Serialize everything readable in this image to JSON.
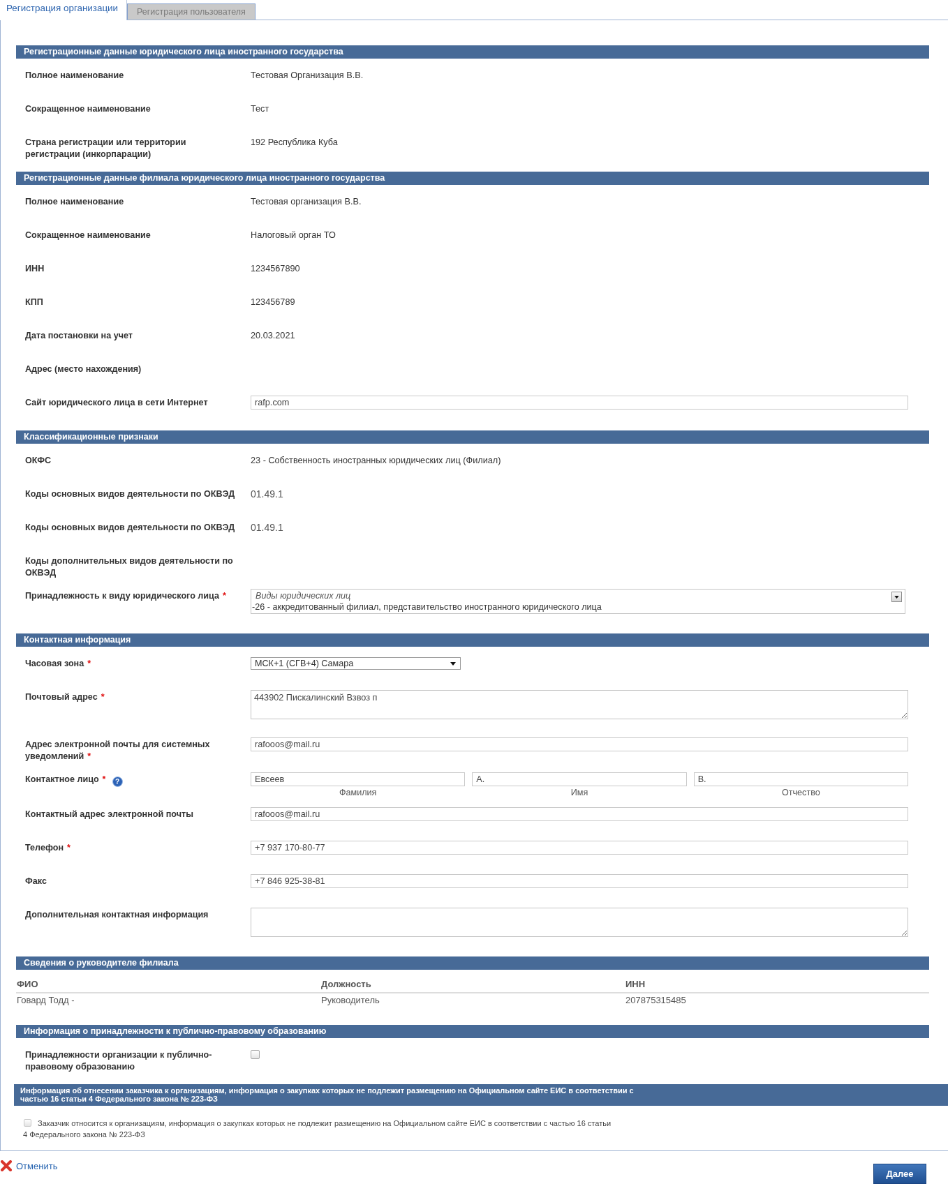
{
  "tabs": [
    {
      "label": "Регистрация организации",
      "selected": true
    },
    {
      "label": "Регистрация пользователя",
      "selected": false
    }
  ],
  "sections": [
    {
      "kind": "form",
      "title": "Регистрационные данные юридического лица иностранного государства",
      "rows": [
        {
          "kind": "text",
          "label": "Полное наименование",
          "value": "Тестовая Организация В.В."
        },
        {
          "kind": "text",
          "label": "Сокращенное наименование",
          "value": "Тест"
        },
        {
          "kind": "text",
          "label": "Страна регистрации или территории регистрации (инкорпарации)",
          "value": "192 Республика Куба"
        }
      ]
    },
    {
      "kind": "form",
      "title": "Регистрационные данные филиала юридического лица иностранного государства",
      "rows": [
        {
          "kind": "text",
          "label": "Полное наименование",
          "value": "Тестовая организация В.В."
        },
        {
          "kind": "text",
          "label": "Сокращенное наименование",
          "value": "Налоговый орган ТО"
        },
        {
          "kind": "text",
          "label": "ИНН",
          "value": "1234567890"
        },
        {
          "kind": "text",
          "label": "КПП",
          "value": "123456789"
        },
        {
          "kind": "text",
          "label": "Дата постановки на учет",
          "value": "20.03.2021"
        },
        {
          "kind": "text",
          "label": "Адрес (место нахождения)"
        },
        {
          "kind": "input",
          "label": "Сайт юридического лица в сети Интернет",
          "value": "rafp.com"
        }
      ]
    },
    {
      "kind": "form",
      "title": "Классификационные признаки",
      "rows": [
        {
          "kind": "text",
          "label": "ОКФС",
          "value": "23 - Собственность иностранных юридических лиц (Филиал)"
        },
        {
          "kind": "code",
          "label": "Коды основных видов деятельности по ОКВЭД",
          "value": "01.49.1"
        },
        {
          "kind": "code",
          "label": "Коды основных видов деятельности по ОКВЭД",
          "value": "01.49.1"
        },
        {
          "kind": "text",
          "label": "Коды дополнительных видов деятельности по ОКВЭД"
        },
        {
          "kind": "multiselect",
          "label": "Принадлежность к виду юридического лица",
          "required_mark": "*",
          "title": "Виды юридических лиц",
          "value": "-26 - аккредитованный филиал, представительство иностранного юридического лица"
        }
      ]
    },
    {
      "kind": "form",
      "title": "Контактная информация",
      "rows": [
        {
          "kind": "select",
          "label": "Часовая зона",
          "required_mark": "*",
          "value": "МСК+1 (СГВ+4) Самара"
        },
        {
          "kind": "textarea",
          "label": "Почтовый адрес",
          "required_mark": "*",
          "value": "443902 Пискалинский Взвоз п"
        },
        {
          "kind": "input",
          "label": "Адрес электронной почты для системных уведомлений",
          "required_mark": "*",
          "value": "rafooos@mail.ru"
        },
        {
          "kind": "name",
          "label": "Контактное лицо",
          "required_mark": "*",
          "help": "?",
          "parts": [
            {
              "value": "Евсеев",
              "caption": "Фамилия"
            },
            {
              "value": "А.",
              "caption": "Имя"
            },
            {
              "value": "В.",
              "caption": "Отчество"
            }
          ]
        },
        {
          "kind": "input",
          "label": "Контактный адрес электронной почты",
          "value": "rafooos@mail.ru"
        },
        {
          "kind": "input",
          "label": "Телефон",
          "required_mark": "*",
          "value": "+7 937 170-80-77"
        },
        {
          "kind": "input",
          "label": "Факс",
          "value": "+7 846 925-38-81"
        },
        {
          "kind": "textarea",
          "label": "Дополнительная контактная информация"
        }
      ]
    },
    {
      "kind": "table",
      "title": "Сведения о руководителе филиала",
      "columns": [
        "ФИО",
        "Должность",
        "ИНН"
      ],
      "rows": [
        [
          "Говард Тодд -",
          "Руководитель",
          "207875315485"
        ]
      ]
    },
    {
      "kind": "form",
      "title": "Информация о принадлежности к публично-правовому образованию",
      "rows": [
        {
          "kind": "checkbox",
          "label": "Принадлежности организации к публично-правовому образованию",
          "checked": false
        }
      ]
    },
    {
      "kind": "notice",
      "title": "Информация об отнесении заказчика к организациям, информация о закупках которых не подлежит размещению на Официальном сайте ЕИС в соответствии с частью 16 статьи 4 Федерального закона № 223-ФЗ",
      "agreement": {
        "checked": false,
        "text": "Заказчик относится к организациям, информация о закупках которых не подлежит размещению на Официальном сайте ЕИС в соответствии с частью 16 статьи 4 Федерального закона № 223-ФЗ"
      }
    }
  ],
  "footer": {
    "cancel": "Отменить",
    "next": "Далее"
  }
}
